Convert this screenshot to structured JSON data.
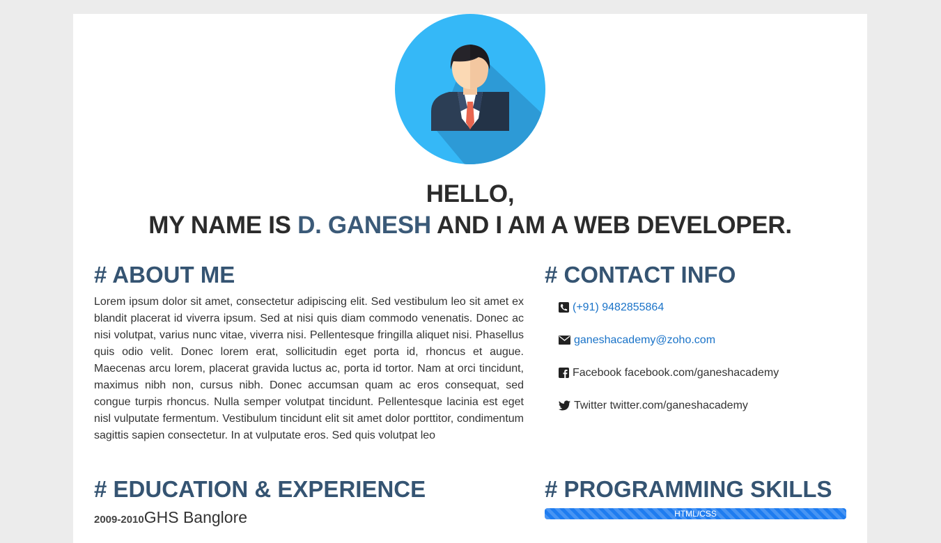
{
  "profile": {
    "avatar_icon": "businessman-avatar-icon",
    "greeting_line1": "HELLO,",
    "greeting_prefix": "MY NAME IS ",
    "name": "D. GANESH",
    "greeting_suffix": " AND I AM A WEB DEVELOPER."
  },
  "about": {
    "title": "# ABOUT ME",
    "text": "Lorem ipsum dolor sit amet, consectetur adipiscing elit. Sed vestibulum leo sit amet ex blandit placerat id viverra ipsum. Sed at nisi quis diam commodo venenatis. Donec ac nisi volutpat, varius nunc vitae, viverra nisi. Pellentesque fringilla aliquet nisi. Phasellus quis odio velit. Donec lorem erat, sollicitudin eget porta id, rhoncus et augue. Maecenas arcu lorem, placerat gravida luctus ac, porta id tortor. Nam at orci tincidunt, maximus nibh non, cursus nibh. Donec accumsan quam ac eros consequat, sed congue turpis rhoncus. Nulla semper volutpat tincidunt. Pellentesque lacinia est eget nisl vulputate fermentum. Vestibulum tincidunt elit sit amet dolor porttitor, condimentum sagittis sapien consectetur. In at vulputate eros. Sed quis volutpat leo"
  },
  "contact": {
    "title": "# CONTACT INFO",
    "phone": {
      "icon": "phone-icon",
      "text": "(+91) 9482855864"
    },
    "email": {
      "icon": "envelope-icon",
      "text": "ganeshacademy@zoho.com"
    },
    "facebook": {
      "icon": "facebook-icon",
      "label": "Facebook",
      "text": "facebook.com/ganeshacademy"
    },
    "twitter": {
      "icon": "twitter-icon",
      "label": "Twitter",
      "text": "twitter.com/ganeshacademy"
    }
  },
  "education": {
    "title": "# EDUCATION & EXPERIENCE",
    "items": [
      {
        "years": "2009-2010",
        "school": "GHS Banglore"
      }
    ]
  },
  "skills": {
    "title": "# PROGRAMMING SKILLS",
    "items": [
      {
        "name": "HTML/CSS",
        "level": 1.0
      }
    ]
  },
  "colors": {
    "background": "#ececec",
    "heading": "#355472",
    "name_accent": "#3b5a78",
    "link": "#1a73c8",
    "progress": "#1e7cf0",
    "avatar_circle": "#35b8f7"
  }
}
